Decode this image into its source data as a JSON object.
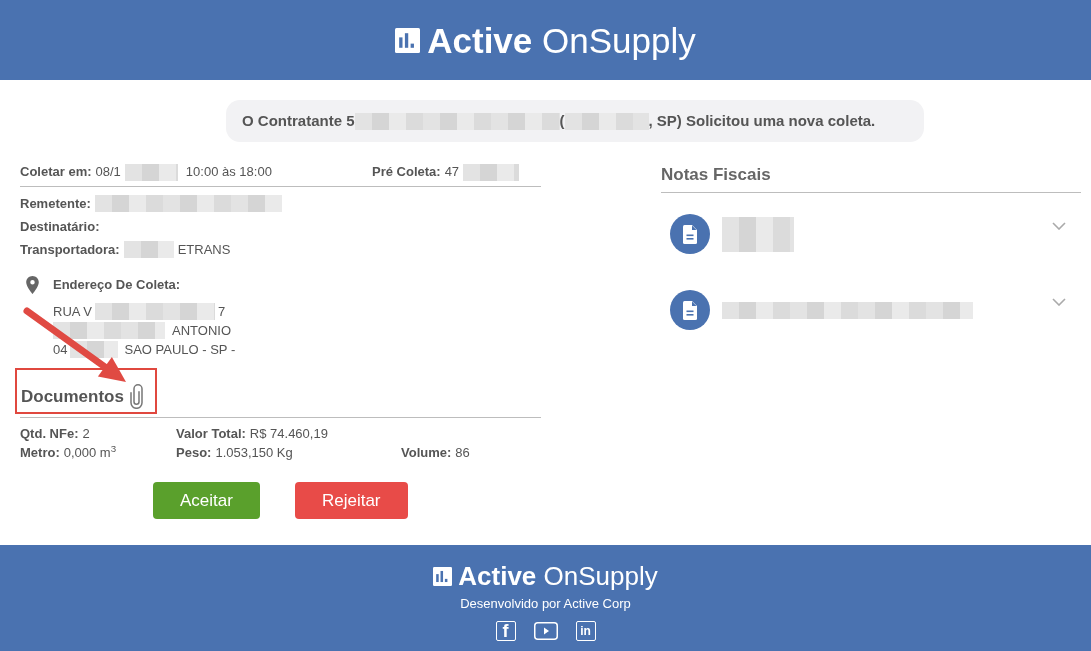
{
  "header": {
    "logo": "**Active** OnSupply"
  },
  "notice": [
    {
      "kind": "text",
      "text": "O Contratante 5"
    },
    {
      "kind": "redacted"
    },
    {
      "kind": "text",
      "text": "("
    },
    {
      "kind": "redacted"
    },
    {
      "kind": "text",
      "text": ", SP) Solicitou uma nova coleta."
    }
  ],
  "pickup": {
    "fields": [
      {
        "label": "Coletar em:",
        "value": [
          {
            "kind": "text",
            "text": "08/1"
          },
          {
            "kind": "redacted"
          },
          {
            "kind": "text",
            "text": "10:00 às 18:00"
          }
        ]
      },
      {
        "label": "Pré Coleta:",
        "value": [
          {
            "kind": "text",
            "text": "47"
          },
          {
            "kind": "redacted"
          }
        ]
      }
    ],
    "parties": [
      {
        "label": "Remetente:",
        "value": [
          {
            "kind": "redacted"
          }
        ]
      },
      {
        "label": "Destinatário:"
      },
      {
        "label": "Transportadora:",
        "value": [
          {
            "kind": "redacted"
          },
          {
            "kind": "text",
            "text": "ETRANS"
          }
        ]
      }
    ],
    "address": {
      "title": "Endereço De Coleta:",
      "lines": [
        [
          {
            "kind": "text",
            "text": "RUA V"
          },
          {
            "kind": "redacted"
          },
          {
            "kind": "text",
            "text": "7"
          }
        ],
        [
          {
            "kind": "redacted"
          },
          {
            "kind": "text",
            "text": "ANTONIO"
          }
        ],
        [
          {
            "kind": "text",
            "text": "04"
          },
          {
            "kind": "redacted"
          },
          {
            "kind": "text",
            "text": "SAO PAULO - SP -"
          }
        ]
      ]
    }
  },
  "documents": {
    "title": "Documentos",
    "highlighted": true
  },
  "summary": [
    [
      {
        "label": "Qtd. NFe:",
        "value": "2"
      },
      {
        "label": "Valor Total:",
        "value": "R$ 74.460,19"
      }
    ],
    [
      {
        "label": "Metro:",
        "value": "0,000 m$^{3}$"
      },
      {
        "label": "Peso:",
        "value": "1.053,150 Kg"
      },
      {
        "label": "Volume:",
        "value": "86"
      }
    ]
  ],
  "actions": [
    {
      "label": "Aceitar",
      "kind": "accept"
    },
    {
      "label": "Rejeitar",
      "kind": "reject"
    }
  ],
  "invoices": {
    "title": "Notas Fiscais",
    "items": [
      {
        "expanded": false,
        "lines": [
          [
            {
              "kind": "redacted"
            }
          ],
          [
            {
              "kind": "redacted"
            }
          ]
        ]
      },
      {
        "expanded": false,
        "lines": [
          [
            {
              "kind": "redacted"
            }
          ]
        ]
      }
    ]
  },
  "footer": {
    "logo": "**Active** OnSupply",
    "credit": "Desenvolvido por Active Corp",
    "social": [
      {
        "kind": "facebook",
        "glyph": "f"
      },
      {
        "kind": "video"
      },
      {
        "kind": "linkedin",
        "glyph": "in"
      }
    ]
  },
  "annotations": [
    {
      "kind": "arrow"
    }
  ]
}
